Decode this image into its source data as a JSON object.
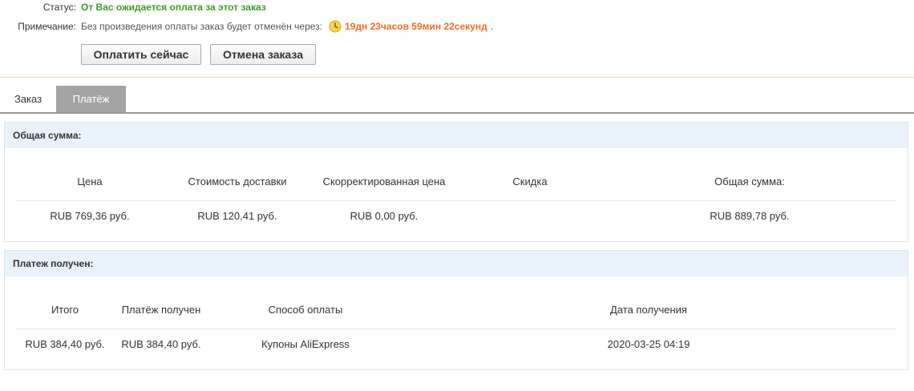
{
  "status": {
    "label": "Статус:",
    "value": "От Вас ожидается оплата за этот заказ",
    "value_color": "#3b9e1f"
  },
  "note": {
    "label": "Примечание:",
    "text": "Без произведения оплаты заказ будет отменён через:",
    "icon": "clock-icon",
    "countdown": "19дн 23часов 59мин 22секунд",
    "countdown_color": "#f26d21",
    "trailing": "."
  },
  "actions": {
    "pay_label": "Оплатить сейчас",
    "cancel_label": "Отмена заказа"
  },
  "tabs": [
    {
      "label": "Заказ",
      "active": false
    },
    {
      "label": "Платёж",
      "active": true
    }
  ],
  "total_panel": {
    "title": "Общая сумма:",
    "columns": [
      "Цена",
      "Стоимость доставки",
      "Скорректированная цена",
      "Скидка",
      "Общая сумма:"
    ],
    "row": [
      "RUB 769,36 руб.",
      "RUB 120,41 руб.",
      "RUB 0,00 руб.",
      "",
      "RUB 889,78 руб."
    ]
  },
  "paid_panel": {
    "title": "Платеж получен:",
    "columns": [
      "Итого",
      "Платёж получен",
      "Способ оплаты",
      "Дата получения"
    ],
    "row": [
      "RUB 384,40 руб.",
      "RUB 384,40 руб.",
      "Купоны AliExpress",
      "2020-03-25 04:19"
    ]
  },
  "colors": {
    "tab_active_bg": "#a4a4a4",
    "panel_header_bg": "#e9f2fb"
  }
}
